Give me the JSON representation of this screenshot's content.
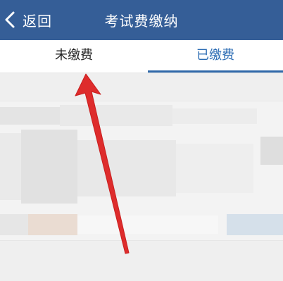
{
  "header": {
    "back_label": "返回",
    "title": "考试费缴纳",
    "background_color": "#355e97"
  },
  "tabs": [
    {
      "label": "未缴费",
      "selected": false
    },
    {
      "label": "已缴费",
      "selected": true
    }
  ],
  "colors": {
    "accent": "#2f68a9",
    "annotation_arrow": "#de2c2c"
  },
  "icons": {
    "back": "chevron-left-icon"
  }
}
